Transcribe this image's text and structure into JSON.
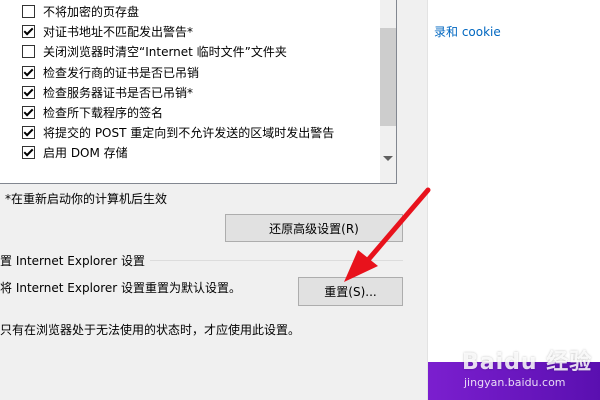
{
  "advanced_list": {
    "items": [
      {
        "label": "不将加密的页存盘",
        "checked": false
      },
      {
        "label": "对证书地址不匹配发出警告*",
        "checked": true
      },
      {
        "label": "关闭浏览器时清空“Internet 临时文件”文件夹",
        "checked": false
      },
      {
        "label": "检查发行商的证书是否已吊销",
        "checked": true
      },
      {
        "label": "检查服务器证书是否已吊销*",
        "checked": true
      },
      {
        "label": "检查所下载程序的签名",
        "checked": true
      },
      {
        "label": "将提交的 POST 重定向到不允许发送的区域时发出警告",
        "checked": true
      },
      {
        "label": "启用 DOM 存储",
        "checked": true
      }
    ]
  },
  "restart_note": "*在重新启动你的计算机后生效",
  "restore_button": "还原高级设置(R)",
  "reset_group": {
    "title": "置 Internet Explorer 设置",
    "description": "将 Internet Explorer 设置重置为默认设置。",
    "reset_button": "重置(S)...",
    "warning": "只有在浏览器处于无法使用的状态时，才应使用此设置。"
  },
  "right_pane": {
    "link_text": "录和 cookie"
  },
  "watermark": {
    "logo": "Baidu 经验",
    "url": "jingyan.baidu.com"
  },
  "colors": {
    "annotation_arrow": "#e8121c",
    "link": "#0067c0",
    "purple": "#6a14c0"
  }
}
